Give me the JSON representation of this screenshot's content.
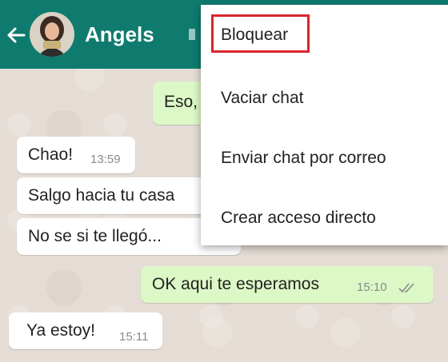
{
  "header": {
    "contact_name": "Angels",
    "color": "#0e7b6e"
  },
  "messages": [
    {
      "direction": "out",
      "text": "Eso,",
      "time": ""
    },
    {
      "direction": "in",
      "text": "Chao!",
      "time": "13:59"
    },
    {
      "direction": "in",
      "text": "Salgo hacia tu casa",
      "time": ""
    },
    {
      "direction": "in",
      "text": "No se si te llegó...",
      "time": ""
    },
    {
      "direction": "out",
      "text": "OK aqui te esperamos",
      "time": "15:10",
      "ticks": "double-check-icon"
    },
    {
      "direction": "in",
      "text": "Ya estoy!",
      "time": "15:11"
    }
  ],
  "menu": {
    "items": [
      {
        "label": "Bloquear",
        "highlighted": true,
        "highlight_color": "#d9262c"
      },
      {
        "label": "Vaciar chat"
      },
      {
        "label": "Enviar chat por correo"
      },
      {
        "label": "Crear acceso directo"
      }
    ]
  },
  "colors": {
    "incoming_bubble": "#ffffff",
    "outgoing_bubble": "#dcf8c6",
    "wallpaper": "#e5ddd5"
  }
}
